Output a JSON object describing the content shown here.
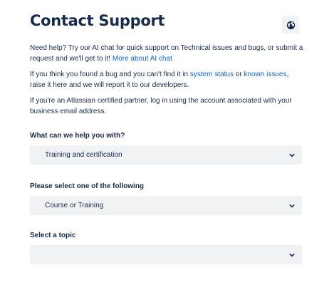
{
  "header": {
    "title": "Contact Support",
    "globe_icon": "globe-icon"
  },
  "intro": {
    "p1_text": "Need help? Try our AI chat for quick support on Technical issues and bugs, or submit a request and we'll get to it! ",
    "p1_link": "More about AI chat",
    "p2_text_a": "If you think you found a bug and you can't find it in ",
    "p2_link_a": "system status",
    "p2_text_b": " or ",
    "p2_link_b": "known issues",
    "p2_text_c": ", raise it here and we will report it to our developers.",
    "p3_text": "If you're an Atlassian certified partner, log in using the account associated with your business email address."
  },
  "form": {
    "fields": [
      {
        "label": "What can we help you with?",
        "value": "Training and certification"
      },
      {
        "label": "Please select one of the following",
        "value": "Course or Training"
      },
      {
        "label": "Select a topic",
        "value": ""
      }
    ]
  },
  "colors": {
    "text": "#172b4d",
    "link": "#0c66e4",
    "field_bg": "#f1f2f4",
    "page_bg": "#ffffff"
  }
}
